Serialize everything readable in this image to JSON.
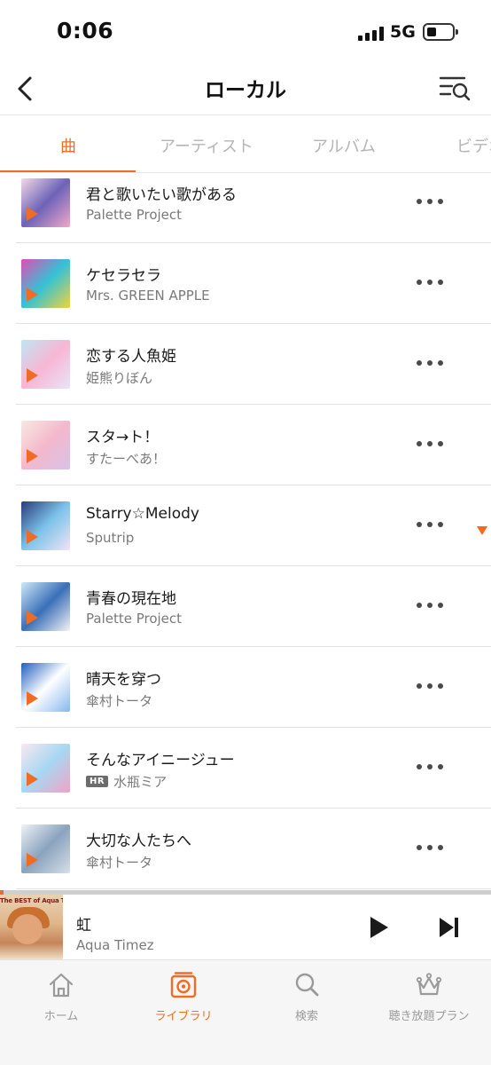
{
  "status_bar": {
    "time": "0:06",
    "network": "5G"
  },
  "header": {
    "title": "ローカル"
  },
  "tabs": [
    {
      "label": "曲",
      "active": true
    },
    {
      "label": "アーティスト",
      "active": false
    },
    {
      "label": "アルバム",
      "active": false
    },
    {
      "label": "ビデオ",
      "active": false
    }
  ],
  "songs": [
    {
      "title": "君と歌いたい歌がある",
      "artist": "Palette Project",
      "hr": false,
      "art_colors": [
        "#f3d9e6",
        "#6d63b8",
        "#f0a8c8"
      ]
    },
    {
      "title": "ケセラセラ",
      "artist": "Mrs. GREEN APPLE",
      "hr": false,
      "art_colors": [
        "#e24db3",
        "#34c2d6",
        "#f4d23a"
      ]
    },
    {
      "title": "恋する人魚姫",
      "artist": "姫熊りぼん",
      "hr": false,
      "art_colors": [
        "#bfe6f4",
        "#f7b6d4",
        "#e9e4f7"
      ]
    },
    {
      "title": "スタ→ト！",
      "artist": "すたーべあ！",
      "hr": false,
      "art_colors": [
        "#f7e9e2",
        "#f4b8cc",
        "#d8c2e8"
      ]
    },
    {
      "title": "Starry☆Melody",
      "artist": "Sputrip",
      "hr": false,
      "art_colors": [
        "#2a3b7a",
        "#7cc3ea",
        "#f1e3f7"
      ]
    },
    {
      "title": "青春の現在地",
      "artist": "Palette Project",
      "hr": false,
      "art_colors": [
        "#cfe9f8",
        "#3a6fb8",
        "#f4f4f4"
      ]
    },
    {
      "title": "晴天を穿つ",
      "artist": "傘村トータ",
      "hr": false,
      "art_colors": [
        "#1f5fbf",
        "#ffffff",
        "#88b7ef"
      ]
    },
    {
      "title": "そんなアイニージュー",
      "artist": "水瓶ミア",
      "hr": true,
      "hr_label": "HR",
      "art_colors": [
        "#f8e9f0",
        "#a7d7f3",
        "#f2a3c4"
      ]
    },
    {
      "title": "大切な人たちへ",
      "artist": "傘村トータ",
      "hr": false,
      "art_colors": [
        "#eef2f6",
        "#8aa3bd",
        "#d6dfe8"
      ]
    }
  ],
  "now_playing": {
    "title": "虹",
    "artist": "Aqua Timez",
    "art_text": "The BEST of Aqua Timez"
  },
  "bottom_nav": [
    {
      "label": "ホーム",
      "icon": "home-icon",
      "active": false
    },
    {
      "label": "ライブラリ",
      "icon": "library-icon",
      "active": true
    },
    {
      "label": "検索",
      "icon": "search-icon",
      "active": false
    },
    {
      "label": "聴き放題プラン",
      "icon": "crown-icon",
      "active": false
    }
  ],
  "colors": {
    "accent": "#ef6c25",
    "text": "#1a1a1a",
    "subtext": "#7a7a7a",
    "inactive": "#b5b5b5"
  }
}
